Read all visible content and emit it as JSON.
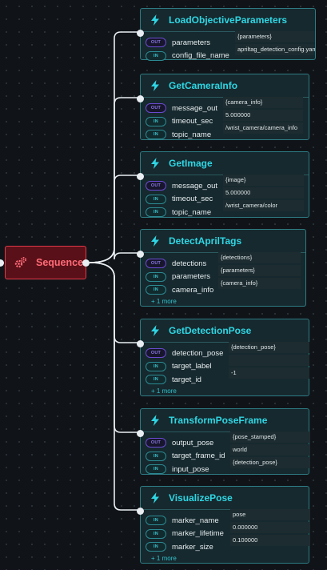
{
  "sequence": {
    "label": "Sequence",
    "icon": "gears-icon",
    "color": "#e03a4a"
  },
  "nodes": [
    {
      "title": "LoadObjectiveParameters",
      "ports": [
        {
          "dir": "OUT",
          "name": "parameters",
          "value": "{parameters}"
        },
        {
          "dir": "IN",
          "name": "config_file_name",
          "value": "apriltag_detection_config.yaml"
        }
      ],
      "more": ""
    },
    {
      "title": "GetCameraInfo",
      "ports": [
        {
          "dir": "OUT",
          "name": "message_out",
          "value": "{camera_info}"
        },
        {
          "dir": "IN",
          "name": "timeout_sec",
          "value": "5.000000"
        },
        {
          "dir": "IN",
          "name": "topic_name",
          "value": "/wrist_camera/camera_info"
        }
      ],
      "more": ""
    },
    {
      "title": "GetImage",
      "ports": [
        {
          "dir": "OUT",
          "name": "message_out",
          "value": "{image}"
        },
        {
          "dir": "IN",
          "name": "timeout_sec",
          "value": "5.000000"
        },
        {
          "dir": "IN",
          "name": "topic_name",
          "value": "/wrist_camera/color"
        }
      ],
      "more": ""
    },
    {
      "title": "DetectAprilTags",
      "ports": [
        {
          "dir": "OUT",
          "name": "detections",
          "value": "{detections}"
        },
        {
          "dir": "IN",
          "name": "parameters",
          "value": "{parameters}"
        },
        {
          "dir": "IN",
          "name": "camera_info",
          "value": "{camera_info}"
        }
      ],
      "more": "+ 1 more"
    },
    {
      "title": "GetDetectionPose",
      "ports": [
        {
          "dir": "OUT",
          "name": "detection_pose",
          "value": "{detection_pose}"
        },
        {
          "dir": "IN",
          "name": "target_label",
          "value": ""
        },
        {
          "dir": "IN",
          "name": "target_id",
          "value": "-1"
        }
      ],
      "more": "+ 1 more"
    },
    {
      "title": "TransformPoseFrame",
      "ports": [
        {
          "dir": "OUT",
          "name": "output_pose",
          "value": "{pose_stamped}"
        },
        {
          "dir": "IN",
          "name": "target_frame_id",
          "value": "world"
        },
        {
          "dir": "IN",
          "name": "input_pose",
          "value": "{detection_pose}"
        }
      ],
      "more": ""
    },
    {
      "title": "VisualizePose",
      "ports": [
        {
          "dir": "IN",
          "name": "marker_name",
          "value": "pose"
        },
        {
          "dir": "IN",
          "name": "marker_lifetime",
          "value": "0.000000"
        },
        {
          "dir": "IN",
          "name": "marker_size",
          "value": "0.100000"
        }
      ],
      "more": "+ 1 more"
    }
  ],
  "colors": {
    "accent": "#2fd6e4",
    "node_border": "#2e7b84",
    "out_pill": "#6a4ad0",
    "in_pill": "#2c8a92"
  }
}
